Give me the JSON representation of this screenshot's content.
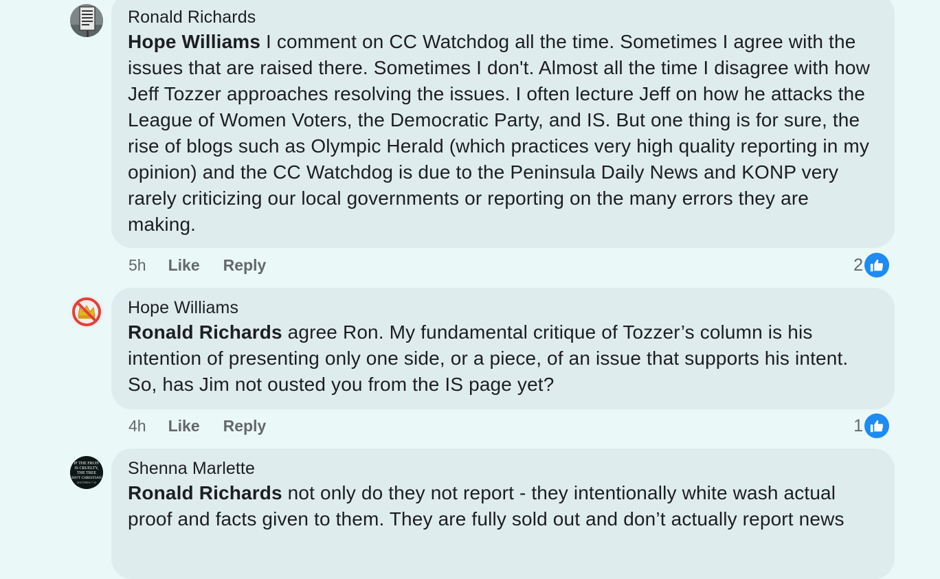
{
  "comments": [
    {
      "author": "Ronald Richards",
      "mention": "Hope Williams",
      "text": " I comment on CC Watchdog all the time. Sometimes I agree with the issues that are raised there. Sometimes I don't. Almost all the time I disagree with how Jeff Tozzer approaches resolving the issues. I often lecture Jeff on how he attacks the League of Women Voters, the Democratic Party, and IS. But one thing is for sure, the rise of blogs such as Olympic Herald (which practices very high quality reporting in my opinion) and the CC Watchdog is due to the Peninsula Daily News and KONP very rarely criticizing our local governments or reporting on the many errors they are making.",
      "time": "5h",
      "like_label": "Like",
      "reply_label": "Reply",
      "reaction_count": "2",
      "avatar_icon": "sign-photo-avatar"
    },
    {
      "author": "Hope Williams",
      "mention": "Ronald Richards",
      "text": " agree Ron. My fundamental critique of Tozzer’s column is his intention of presenting only one side, or a piece, of an issue that supports his intent. So, has Jim not ousted you from the IS page yet?",
      "time": "4h",
      "like_label": "Like",
      "reply_label": "Reply",
      "reaction_count": "1",
      "avatar_icon": "no-crown-avatar"
    },
    {
      "author": "Shenna Marlette",
      "mention": "Ronald Richards",
      "text": " not only do they not report - they intentionally white wash actual proof and facts given to them. They are fully sold out and don’t actually report news",
      "avatar_icon": "text-quote-avatar",
      "avatar_text": [
        "IF THE FRUIT",
        "IS CRUELTY,",
        "THE TREE",
        "ISN'T CHRISTIAN",
        "MATTHEW 7:16"
      ]
    }
  ],
  "colors": {
    "page_bg": "#eaf8f7",
    "bubble_bg": "#dfeced",
    "meta_text": "#65676b",
    "like_blue": "#1d8bf1"
  }
}
